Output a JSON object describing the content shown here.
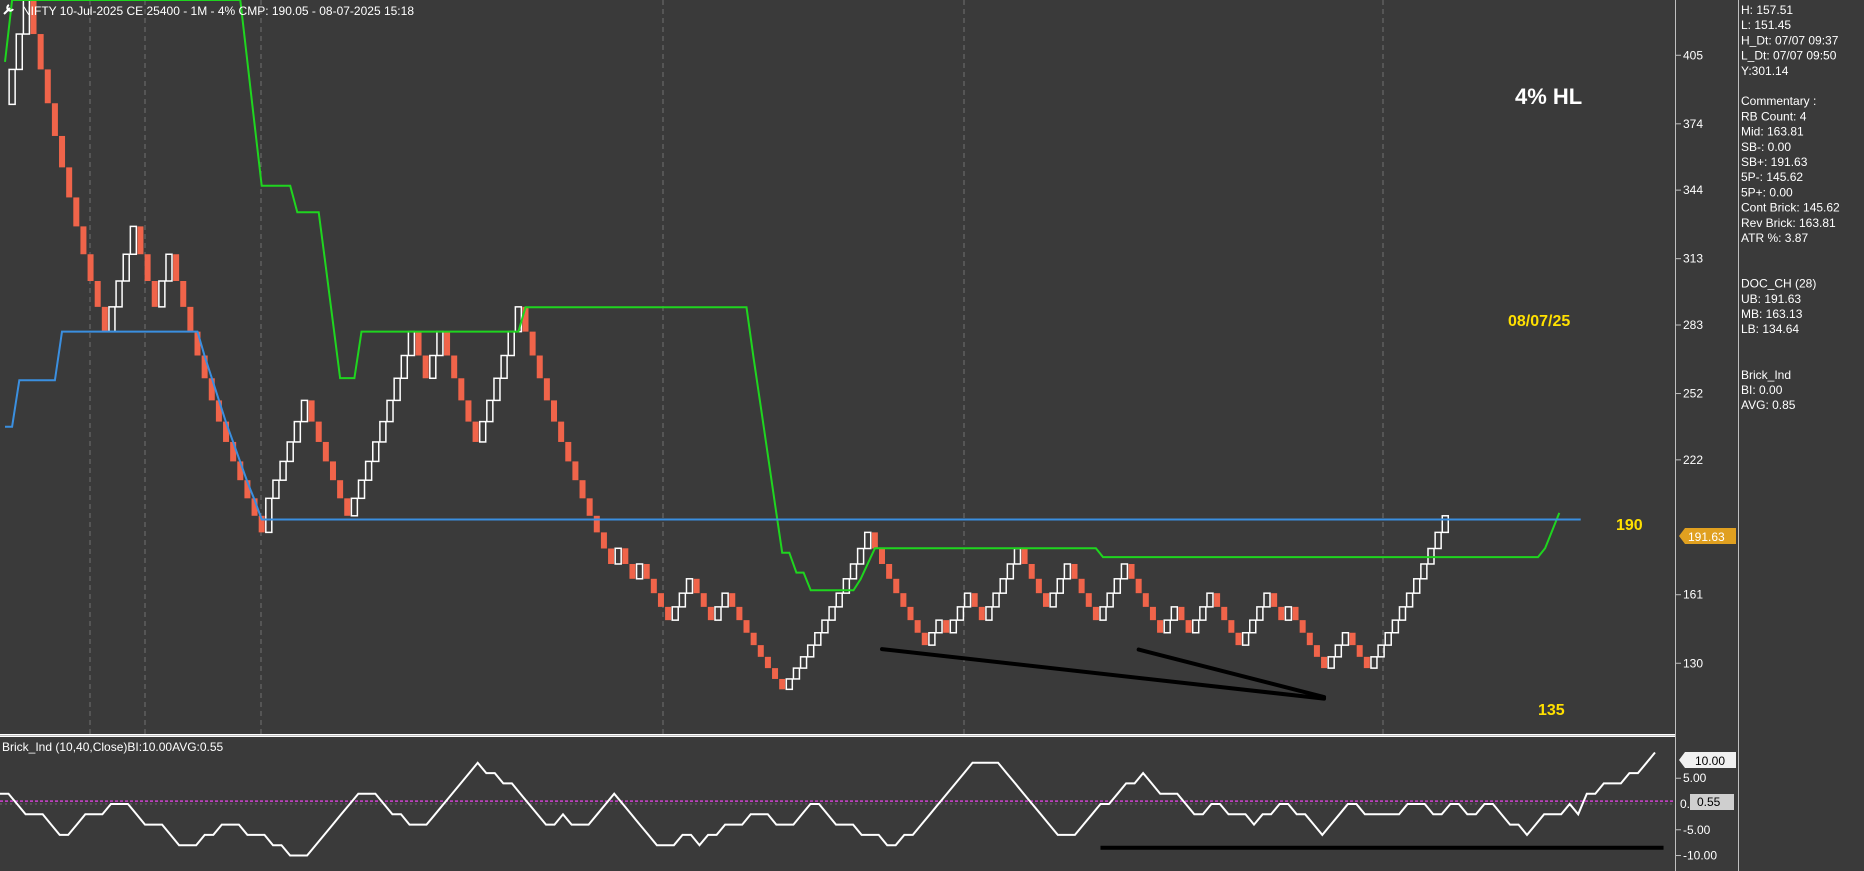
{
  "title_bar": "NIFTY 10-Jul-2025 CE 25400 - 1M - 4% CMP: 190.05 - 08-07-2025 15:18",
  "info_panel": [
    "H: 157.51",
    "L: 151.45",
    "H_Dt: 07/07 09:37",
    "L_Dt: 07/07 09:50",
    "Y:301.14",
    "",
    "Commentary :",
    "RB Count: 4",
    "Mid: 163.81",
    "SB-: 0.00",
    "SB+: 191.63",
    "5P-: 145.62",
    "5P+: 0.00",
    "Cont Brick: 145.62",
    "Rev Brick: 163.81",
    "ATR %: 3.87",
    "",
    "",
    "DOC_CH (28)",
    "UB: 191.63",
    "MB: 163.13",
    "LB: 134.64",
    "",
    "",
    "Brick_Ind",
    "BI: 0.00",
    "AVG: 0.85"
  ],
  "annotations": {
    "main_label": "4% HL",
    "date_label": "08/07/25",
    "high_label": "190",
    "low_label": "135"
  },
  "colors": {
    "background": "#3a3a3a",
    "grid": "#707070",
    "up_brick": "#ffffff",
    "down_brick": "#f0644a",
    "upper_band": "#1fd51f",
    "lower_band": "#3a8fe0",
    "oscillator": "#ffffff",
    "oscillator_avg": "#d040d0",
    "highlight": "#ffe000",
    "price_tag": "#e0a020",
    "trendline": "#000000"
  },
  "chart_data": [
    {
      "type": "renko",
      "title": "NIFTY 10-Jul-2025 CE 25400 - 1M - 4% CMP: 190.05 - 08-07-2025 15:18",
      "y_ticks": [
        405,
        374,
        344,
        313,
        283,
        252,
        222,
        191.63,
        161,
        130
      ],
      "ylim": [
        98,
        430
      ],
      "brick_closes": [
        382.8,
        398.6,
        414.6,
        431.2,
        414.6,
        398.6,
        383.3,
        368.5,
        354.3,
        340.7,
        327.6,
        315.0,
        302.9,
        291.2,
        280.0,
        291.2,
        302.9,
        315.0,
        327.6,
        315.0,
        302.9,
        291.2,
        302.9,
        315.0,
        302.9,
        291.2,
        280.0,
        269.2,
        258.9,
        248.9,
        239.3,
        230.1,
        221.3,
        212.8,
        204.6,
        196.7,
        189.2,
        204.6,
        212.8,
        221.3,
        230.1,
        239.3,
        248.9,
        239.3,
        230.1,
        221.3,
        212.8,
        204.6,
        196.7,
        204.6,
        212.8,
        221.3,
        230.1,
        239.3,
        248.9,
        258.9,
        269.2,
        280.0,
        269.2,
        258.9,
        269.2,
        280.0,
        269.2,
        258.9,
        248.9,
        239.3,
        230.1,
        239.3,
        248.9,
        258.9,
        269.2,
        280.0,
        291.2,
        280.0,
        269.2,
        258.9,
        248.9,
        239.3,
        230.1,
        221.3,
        212.8,
        204.6,
        196.7,
        189.2,
        181.9,
        174.9,
        182.0,
        174.9,
        168.2,
        174.9,
        168.2,
        161.7,
        155.5,
        149.5,
        155.5,
        161.7,
        168.2,
        161.7,
        155.5,
        149.5,
        155.5,
        161.7,
        155.5,
        149.5,
        143.8,
        138.2,
        132.9,
        127.8,
        122.9,
        118.2,
        122.9,
        127.8,
        132.9,
        138.2,
        143.8,
        149.5,
        155.5,
        161.7,
        168.2,
        174.9,
        181.9,
        189.2,
        181.9,
        174.9,
        168.2,
        161.7,
        155.5,
        149.5,
        143.8,
        138.2,
        143.8,
        149.5,
        143.8,
        149.5,
        155.5,
        161.7,
        155.5,
        149.5,
        155.5,
        161.7,
        168.2,
        174.9,
        181.9,
        174.9,
        168.2,
        161.7,
        155.5,
        161.7,
        168.2,
        174.9,
        168.2,
        161.7,
        155.5,
        149.5,
        155.5,
        161.7,
        168.2,
        174.9,
        168.2,
        161.7,
        155.5,
        149.5,
        143.8,
        149.5,
        155.5,
        149.5,
        143.8,
        149.5,
        155.5,
        161.7,
        155.5,
        149.5,
        143.8,
        138.2,
        143.8,
        149.5,
        155.5,
        161.7,
        155.5,
        149.5,
        155.5,
        149.5,
        143.8,
        138.2,
        132.9,
        127.8,
        132.9,
        138.2,
        143.8,
        138.2,
        132.9,
        127.8,
        132.9,
        138.2,
        143.8,
        149.5,
        155.5,
        161.7,
        168.2,
        174.9,
        181.9,
        189.2,
        196.7
      ],
      "upper_band": [
        402,
        430,
        430,
        430,
        430,
        430,
        430,
        430,
        430,
        430,
        430,
        430,
        430,
        430,
        430,
        430,
        430,
        430,
        430,
        430,
        430,
        430,
        430,
        430,
        430,
        430,
        430,
        430,
        430,
        430,
        430,
        430,
        430,
        430,
        402,
        374,
        346,
        346,
        346,
        346,
        346,
        334,
        334,
        334,
        334,
        309,
        284,
        259,
        259,
        259,
        280,
        280,
        280,
        280,
        280,
        280,
        280,
        280,
        280,
        280,
        280,
        280,
        280,
        280,
        280,
        280,
        280,
        280,
        280,
        280,
        280,
        280,
        280,
        291,
        291,
        291,
        291,
        291,
        291,
        291,
        291,
        291,
        291,
        291,
        291,
        291,
        291,
        291,
        291,
        291,
        291,
        291,
        291,
        291,
        291,
        291,
        291,
        291,
        291,
        291,
        291,
        291,
        291,
        291,
        291,
        268,
        246,
        224,
        202,
        180,
        180,
        171,
        171,
        163,
        163,
        163,
        163,
        163,
        163,
        163,
        168,
        175,
        182,
        182,
        182,
        182,
        182,
        182,
        182,
        182,
        182,
        182,
        182,
        182,
        182,
        182,
        182,
        182,
        182,
        182,
        182,
        182,
        182,
        182,
        182,
        182,
        182,
        182,
        182,
        182,
        182,
        182,
        182,
        182,
        178,
        178,
        178,
        178,
        178,
        178,
        178,
        178,
        178,
        178,
        178,
        178,
        178,
        178,
        178,
        178,
        178,
        178,
        178,
        178,
        178,
        178,
        178,
        178,
        178,
        178,
        178,
        178,
        178,
        178,
        178,
        178,
        178,
        178,
        178,
        178,
        178,
        178,
        178,
        178,
        178,
        178,
        178,
        178,
        178,
        178,
        178,
        178,
        178,
        178,
        178,
        178,
        178,
        178,
        178,
        178,
        178,
        178,
        178,
        178,
        178,
        178,
        182,
        190,
        198
      ],
      "lower_band": [
        237,
        237,
        258,
        258,
        258,
        258,
        258,
        258,
        280,
        280,
        280,
        280,
        280,
        280,
        280,
        280,
        280,
        280,
        280,
        280,
        280,
        280,
        280,
        280,
        280,
        280,
        280,
        280,
        269,
        259,
        249,
        239,
        230,
        221,
        212,
        204,
        195,
        195,
        195,
        195,
        195,
        195,
        195,
        195,
        195,
        195,
        195,
        195,
        195,
        195,
        195,
        195,
        195,
        195,
        195,
        195,
        195,
        195,
        195,
        195,
        195,
        195,
        195,
        195,
        195,
        195,
        195,
        195,
        195,
        195,
        195,
        195,
        195,
        195,
        195,
        195,
        195,
        195,
        195,
        195,
        195,
        195,
        195,
        195,
        195,
        195,
        195,
        195,
        195,
        195,
        195,
        195,
        195,
        195,
        195,
        195,
        195,
        195,
        195,
        195,
        195,
        195,
        195,
        195,
        195,
        195,
        195,
        195,
        195,
        195,
        195,
        195,
        195,
        195,
        195,
        195,
        195,
        195,
        195,
        195,
        195,
        195,
        195,
        195,
        195,
        195,
        195,
        195,
        195,
        195,
        195,
        195,
        195,
        195,
        195,
        195,
        195,
        195,
        195,
        195,
        195,
        195,
        195,
        195,
        195,
        195,
        195,
        195,
        195,
        195,
        195,
        195,
        195,
        195,
        195,
        195,
        195,
        195,
        195,
        195,
        195,
        195,
        195,
        195,
        195,
        195,
        195,
        195,
        195,
        195,
        195,
        195,
        195,
        195,
        195,
        195,
        195,
        195,
        195,
        195,
        195,
        195,
        195,
        195,
        195,
        195,
        195,
        195,
        195,
        195,
        195,
        195,
        195,
        195,
        195,
        195,
        195,
        195,
        195,
        195,
        195,
        195,
        195,
        195,
        195,
        195,
        195,
        195,
        195,
        195,
        195,
        195,
        195,
        195,
        195,
        195,
        195,
        195,
        195,
        195,
        195,
        195
      ],
      "current_price_tag": "191.63",
      "trendlines": [
        {
          "from_brick": 123,
          "from_value": 136.4,
          "to_brick": 185,
          "to_value": 114.0
        },
        {
          "from_brick": 159,
          "from_value": 136.2,
          "to_brick": 185,
          "to_value": 114.7
        }
      ]
    },
    {
      "type": "line",
      "title": "Brick_Ind (10,40,Close)BI:10.00AVG:0.55",
      "y_ticks": [
        10.0,
        5.0,
        0.0,
        -5.0,
        -10.0
      ],
      "ylim": [
        -13,
        13
      ],
      "average_value": 0.55,
      "current_value": "10.00",
      "average_label": "0.55",
      "values": [
        2,
        2,
        0,
        -2,
        -2,
        -2,
        -4,
        -6,
        -6,
        -4,
        -2,
        -2,
        -2,
        0,
        0,
        0,
        -2,
        -4,
        -4,
        -4,
        -6,
        -8,
        -8,
        -8,
        -6,
        -6,
        -4,
        -4,
        -4,
        -6,
        -6,
        -6,
        -8,
        -8,
        -10,
        -10,
        -10,
        -8,
        -6,
        -4,
        -2,
        0,
        2,
        2,
        2,
        0,
        -2,
        -2,
        -4,
        -4,
        -4,
        -2,
        0,
        2,
        4,
        6,
        8,
        6,
        6,
        4,
        4,
        2,
        0,
        -2,
        -4,
        -4,
        -2,
        -4,
        -4,
        -4,
        -2,
        0,
        2,
        0,
        -2,
        -4,
        -6,
        -8,
        -8,
        -8,
        -6,
        -6,
        -8,
        -6,
        -6,
        -4,
        -4,
        -4,
        -2,
        -2,
        -2,
        -4,
        -4,
        -4,
        -2,
        0,
        0,
        -2,
        -4,
        -4,
        -4,
        -6,
        -6,
        -6,
        -8,
        -8,
        -6,
        -6,
        -4,
        -2,
        0,
        2,
        4,
        6,
        8,
        8,
        8,
        8,
        6,
        4,
        2,
        0,
        -2,
        -4,
        -6,
        -6,
        -6,
        -4,
        -2,
        0,
        0,
        2,
        4,
        4,
        6,
        4,
        2,
        2,
        2,
        0,
        -2,
        -2,
        0,
        0,
        -2,
        -2,
        -2,
        -4,
        -2,
        -2,
        0,
        0,
        -2,
        -2,
        -4,
        -6,
        -4,
        -2,
        0,
        0,
        -2,
        -2,
        -2,
        -2,
        -2,
        0,
        0,
        0,
        -2,
        -2,
        0,
        0,
        -2,
        -2,
        0,
        0,
        -2,
        -4,
        -4,
        -6,
        -4,
        -2,
        -2,
        -2,
        0,
        -2,
        2,
        2,
        4,
        4,
        4,
        6,
        6,
        8,
        10
      ],
      "trendline": {
        "from_index": 129,
        "to_index": 195,
        "value": -8.5
      }
    }
  ]
}
